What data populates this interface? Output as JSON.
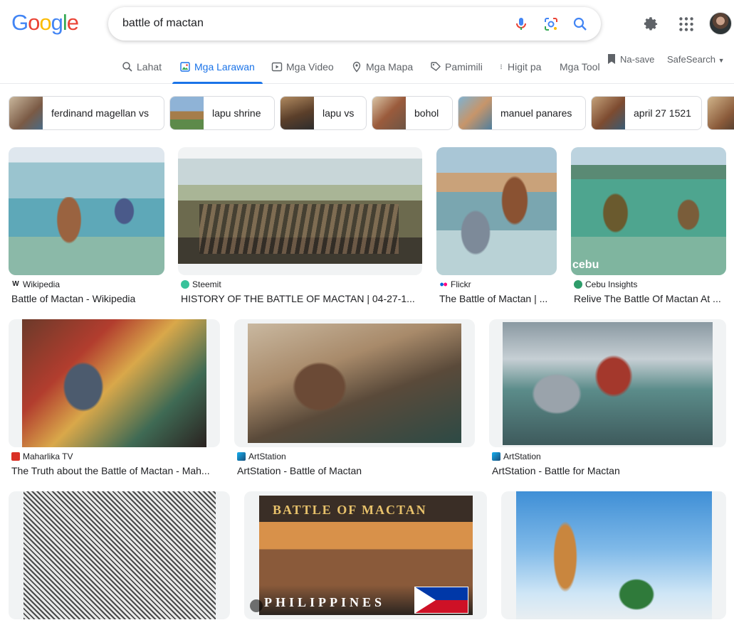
{
  "logo": {
    "text": "Google",
    "letters": [
      {
        "c": "G",
        "color": "#4285f4"
      },
      {
        "c": "o",
        "color": "#ea4335"
      },
      {
        "c": "o",
        "color": "#fbbc05"
      },
      {
        "c": "g",
        "color": "#4285f4"
      },
      {
        "c": "l",
        "color": "#34a853"
      },
      {
        "c": "e",
        "color": "#ea4335"
      }
    ]
  },
  "search": {
    "value": "battle of mactan"
  },
  "icons": {
    "mic": "mic-icon",
    "lens": "lens-icon",
    "search": "search-icon",
    "settings": "gear-icon",
    "apps": "apps-grid-icon"
  },
  "tabs": [
    {
      "label": "Lahat",
      "icon": "search-icon"
    },
    {
      "label": "Mga Larawan",
      "icon": "image-icon",
      "active": true
    },
    {
      "label": "Mga Video",
      "icon": "play-icon"
    },
    {
      "label": "Mga Mapa",
      "icon": "pin-icon"
    },
    {
      "label": "Pamimili",
      "icon": "tag-icon"
    },
    {
      "label": "Higit pa",
      "icon": "more-vert-icon"
    },
    {
      "label": "Mga Tool",
      "icon": ""
    }
  ],
  "saved_label": "Na-save",
  "safesearch_label": "SafeSearch",
  "chips": [
    {
      "label": "ferdinand magellan vs",
      "thumb": "#8b6f5a"
    },
    {
      "label": "lapu shrine",
      "thumb": "#6b8fb3"
    },
    {
      "label": "lapu vs",
      "thumb": "#7a5c43"
    },
    {
      "label": "bohol",
      "thumb": "#a0715a"
    },
    {
      "label": "manuel panares",
      "thumb": "#6f9ab0"
    },
    {
      "label": "april 27 1521",
      "thumb": "#94735a"
    },
    {
      "label": "",
      "thumb": "#8a6a50"
    }
  ],
  "results": [
    {
      "source": "Wikipedia",
      "title": "Battle of Mactan - Wikipedia",
      "fav": "#ffffff"
    },
    {
      "source": "Steemit",
      "title": "HISTORY OF THE BATTLE OF MACTAN | 04-27-1...",
      "fav": "#38c29a"
    },
    {
      "source": "Flickr",
      "title": "The Battle of Mactan | ...",
      "fav": "#ff0084"
    },
    {
      "source": "Cebu Insights",
      "title": "Relive The Battle Of Mactan At ...",
      "fav": "#2e9c6a"
    },
    {
      "source": "Maharlika TV",
      "title": "The Truth about the Battle of Mactan - Mah...",
      "fav": "#d93025"
    },
    {
      "source": "ArtStation",
      "title": "ArtStation - Battle of Mactan",
      "fav": "#13aff0"
    },
    {
      "source": "ArtStation",
      "title": "ArtStation - Battle for Mactan",
      "fav": "#13aff0"
    },
    {
      "source": "",
      "title": "",
      "fav": ""
    },
    {
      "source": "",
      "title": "",
      "fav": ""
    },
    {
      "source": "",
      "title": "",
      "fav": ""
    }
  ],
  "image_overlays": {
    "cebu_watermark": "cebu",
    "poster_title": "BATTLE OF MACTAN",
    "poster_subtitle": "PHILIPPINES"
  },
  "colors": {
    "accent": "#1a73e8",
    "text_secondary": "#5f6368"
  }
}
